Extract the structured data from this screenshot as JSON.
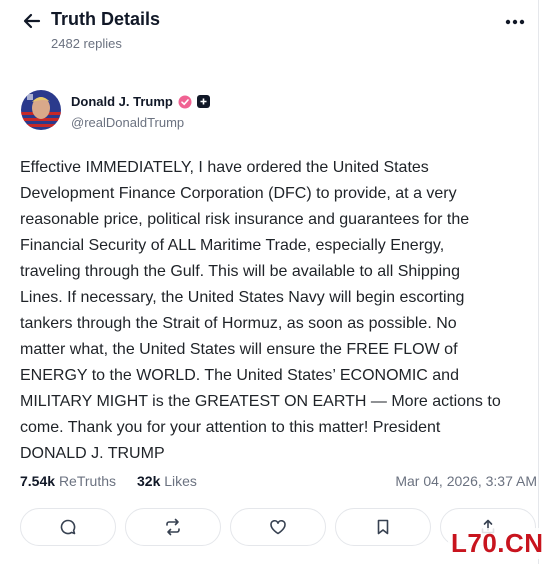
{
  "header": {
    "title": "Truth Details",
    "replies": "2482 replies",
    "back_icon": "arrow-left-icon",
    "more_icon": "ellipsis-icon"
  },
  "author": {
    "name": "Donald J. Trump",
    "handle": "@realDonaldTrump",
    "verified_color": "#f06292"
  },
  "post": {
    "text": "Effective IMMEDIATELY, I have ordered the United States\nDevelopment Finance Corporation (DFC) to provide, at a very\nreasonable price, political risk insurance and guarantees for the\nFinancial Security of ALL Maritime Trade, especially Energy,\ntraveling through the Gulf. This will be available to all Shipping\nLines. If necessary, the United States Navy will begin escorting\ntankers through the Strait of Hormuz, as soon as possible. No\nmatter what, the United States will ensure the FREE FLOW of\nENERGY to the WORLD. The United States’ ECONOMIC and\nMILITARY MIGHT is the GREATEST ON EARTH — More actions to\ncome. Thank you for your attention to this matter! President\nDONALD J. TRUMP",
    "retruths_count": "7.54k",
    "retruths_label": "ReTruths",
    "likes_count": "32k",
    "likes_label": "Likes",
    "timestamp": "Mar 04, 2026, 3:37 AM"
  },
  "actions": [
    "reply-icon",
    "retruth-icon",
    "heart-icon",
    "bookmark-icon",
    "share-icon"
  ],
  "watermark": "L70.CN"
}
